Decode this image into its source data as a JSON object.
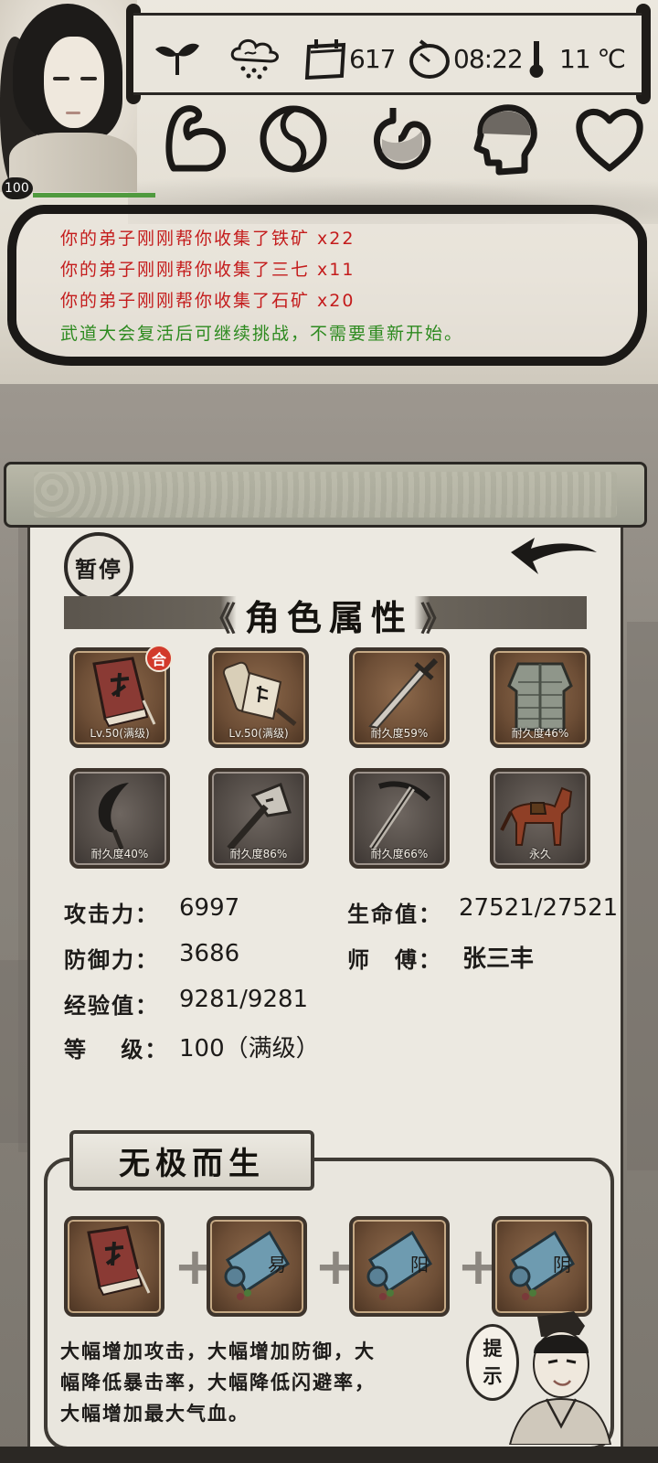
{
  "player": {
    "level": "100",
    "hp_fraction": 1.0
  },
  "status_bar": {
    "days": "617",
    "time": "08:22",
    "temperature": "11 ℃",
    "icons": [
      "sprout-icon",
      "cloud-rain-icon",
      "calendar-icon",
      "clock-icon",
      "thermometer-icon"
    ]
  },
  "attributes": {
    "icons": [
      "muscle-arm-icon",
      "yin-yang-icon",
      "stomach-icon",
      "head-mind-icon",
      "heart-icon"
    ]
  },
  "messages": [
    {
      "text": "你的弟子刚刚帮你收集了铁矿 x22",
      "color": "red"
    },
    {
      "text": "你的弟子刚刚帮你收集了三七 x11",
      "color": "red"
    },
    {
      "text": "你的弟子刚刚帮你收集了石矿 x20",
      "color": "red"
    },
    {
      "text": "武道大会复活后可继续挑战，不需要重新开始。",
      "color": "green"
    }
  ],
  "panel": {
    "pause_label": "暂停",
    "title": "角色属性",
    "title_left_chevron": "《",
    "title_right_chevron": "》"
  },
  "items": [
    {
      "name": "skill-book",
      "label": "Lv.50(满级)",
      "badge": "合"
    },
    {
      "name": "scroll",
      "label": "Lv.50(满级)"
    },
    {
      "name": "sword",
      "label": "耐久度59%"
    },
    {
      "name": "armor",
      "label": "耐久度46%"
    },
    {
      "name": "sickle",
      "label": "耐久度40%"
    },
    {
      "name": "axe",
      "label": "耐久度86%"
    },
    {
      "name": "pickaxe",
      "label": "耐久度66%"
    },
    {
      "name": "horse",
      "label": "永久"
    }
  ],
  "stats": {
    "attack_label": "攻击力：",
    "attack": "6997",
    "defense_label": "防御力：",
    "defense": "3686",
    "exp_label": "经验值：",
    "exp": "9281/9281",
    "level_label": "等　 级：",
    "level": "100（满级）",
    "hp_label": "生命值：",
    "hp": "27521/27521",
    "master_label": "师　傅：",
    "master": "张三丰"
  },
  "wuji": {
    "title": "无极而生",
    "ingredients": [
      "book",
      "scroll-yi",
      "scroll-yang",
      "scroll-yin"
    ],
    "scroll_chars": [
      "易",
      "阳",
      "阴"
    ],
    "plus": "+",
    "desc_lines": [
      "大幅增加攻击，大幅增加防御，大",
      "幅降低暴击率，大幅降低闪避率，",
      "大幅增加最大气血。"
    ],
    "hint_chars": [
      "提",
      "示"
    ]
  },
  "colors": {
    "msg_red": "#c41c1c",
    "msg_green": "#2d8a1f",
    "hp_bar": "#4f9a3e",
    "badge_red": "#d23a2b"
  }
}
